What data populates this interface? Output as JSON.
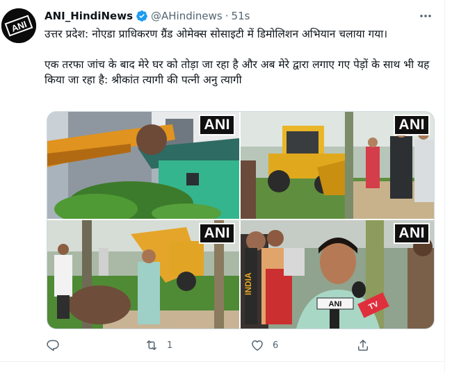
{
  "account": {
    "display_name": "ANI_HindiNews",
    "handle": "@AHindinews",
    "separator": "·",
    "time": "51s",
    "avatar_text": "ANI"
  },
  "tweet": {
    "text": "उत्तर प्रदेश: नोएडा प्राधिकरण ग्रैंड ओमेक्स सोसाइटी में डिमोलिशन अभियान चलाया गया।\n\nएक तरफा जांच के बाद मेरे घर को तोड़ा जा रहा है  और अब मेरे द्वारा लगाए गए पेड़ों के साथ भी यह किया जा रहा है: श्रीकांत त्यागी की पत्नी अनु त्यागी"
  },
  "media": {
    "watermark": "ANI",
    "mic_text_1": "ANI",
    "mic_text_2": "INDIA",
    "mic_text_3": "TV"
  },
  "actions": {
    "reply_count": "",
    "retweet_count": "1",
    "like_count": "6"
  },
  "colors": {
    "secondary_text": "#536471",
    "verified_blue": "#1d9bf0",
    "border": "#cfd9de"
  }
}
